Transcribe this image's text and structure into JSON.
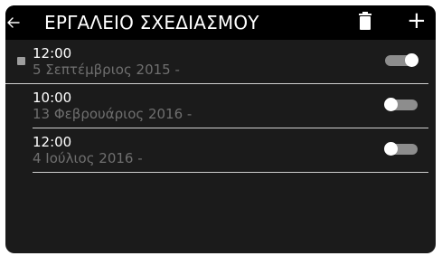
{
  "header": {
    "title": "ΕΡΓΑΛΕΙΟ ΣΧΕΔΙΑΣΜΟΥ",
    "icons": {
      "back": "arrow-left-icon",
      "delete": "trash-icon",
      "add": "plus-icon"
    }
  },
  "schedules": [
    {
      "time": "12:00",
      "date": "5 Σεπτέμβριος 2015 -",
      "detail": "",
      "enabled": true,
      "selected": true
    },
    {
      "time": "10:00",
      "date": "13 Φεβρουάριος 2016 -",
      "detail": "",
      "enabled": false,
      "selected": false
    },
    {
      "time": "12:00",
      "date": "4 Ιούλιος 2016 -",
      "detail": "",
      "enabled": false,
      "selected": false
    }
  ],
  "colors": {
    "background": "#1b1b1b",
    "header": "#000000",
    "text": "#ffffff",
    "muted": "#6f6f6f",
    "divider": "#cfcfcf",
    "toggle_track": "#8d8d8d",
    "toggle_knob": "#ffffff"
  }
}
